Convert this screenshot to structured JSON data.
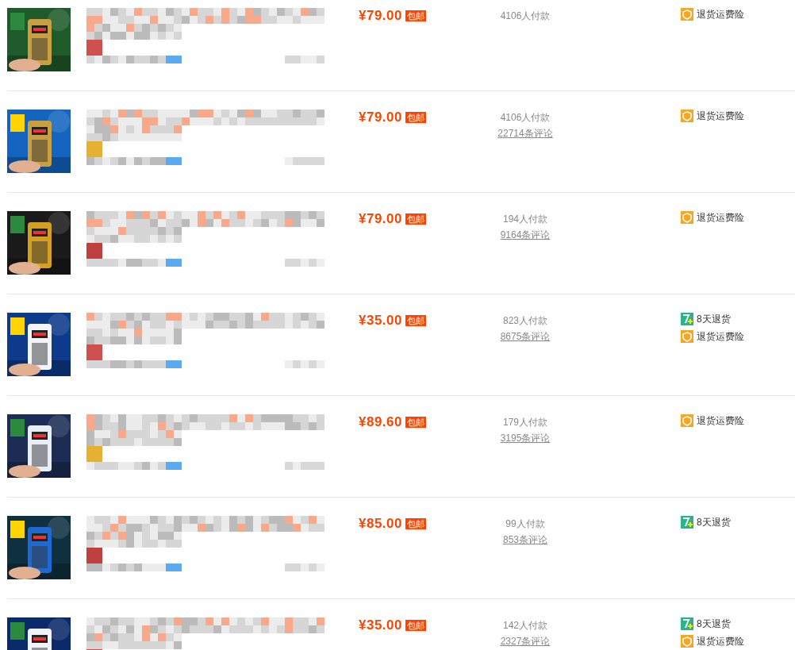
{
  "rows": [
    {
      "image": {
        "kind": "picture"
      },
      "price": "¥79.00",
      "shipping_badge": "包邮",
      "sales": "4106人付款",
      "services": [
        {
          "kind": "insurance",
          "label": "退货运费险"
        }
      ]
    },
    {
      "image": {
        "kind": "picture"
      },
      "price": "¥79.00",
      "shipping_badge": "包邮",
      "sales": "4106人付款",
      "reviews": "22714条评论",
      "services": [
        {
          "kind": "insurance",
          "label": "退货运费险"
        }
      ]
    },
    {
      "image": {
        "kind": "picture"
      },
      "price": "¥79.00",
      "shipping_badge": "包邮",
      "sales": "194人付款",
      "reviews": "9164条评论",
      "services": [
        {
          "kind": "insurance",
          "label": "退货运费险"
        }
      ]
    },
    {
      "image": {
        "kind": "picture"
      },
      "price": "¥35.00",
      "shipping_badge": "包邮",
      "sales": "823人付款",
      "reviews": "8675条评论",
      "services": [
        {
          "kind": "return7",
          "label": "8天退货"
        },
        {
          "kind": "insurance",
          "label": "退货运费险"
        }
      ]
    },
    {
      "image": {
        "kind": "picture"
      },
      "price": "¥89.60",
      "shipping_badge": "包邮",
      "sales": "179人付款",
      "reviews": "3195条评论",
      "services": [
        {
          "kind": "insurance",
          "label": "退货运费险"
        }
      ]
    },
    {
      "image": {
        "kind": "picture"
      },
      "price": "¥85.00",
      "shipping_badge": "包邮",
      "sales": "99人付款",
      "reviews": "853条评论",
      "services": [
        {
          "kind": "return7",
          "label": "8天退货"
        }
      ]
    },
    {
      "image": {
        "kind": "picture"
      },
      "price": "¥35.00",
      "shipping_badge": "包邮",
      "sales": "142人付款",
      "reviews": "2327条评论",
      "services": [
        {
          "kind": "return7",
          "label": "8天退货"
        },
        {
          "kind": "insurance",
          "label": "退货运费险"
        }
      ]
    }
  ]
}
